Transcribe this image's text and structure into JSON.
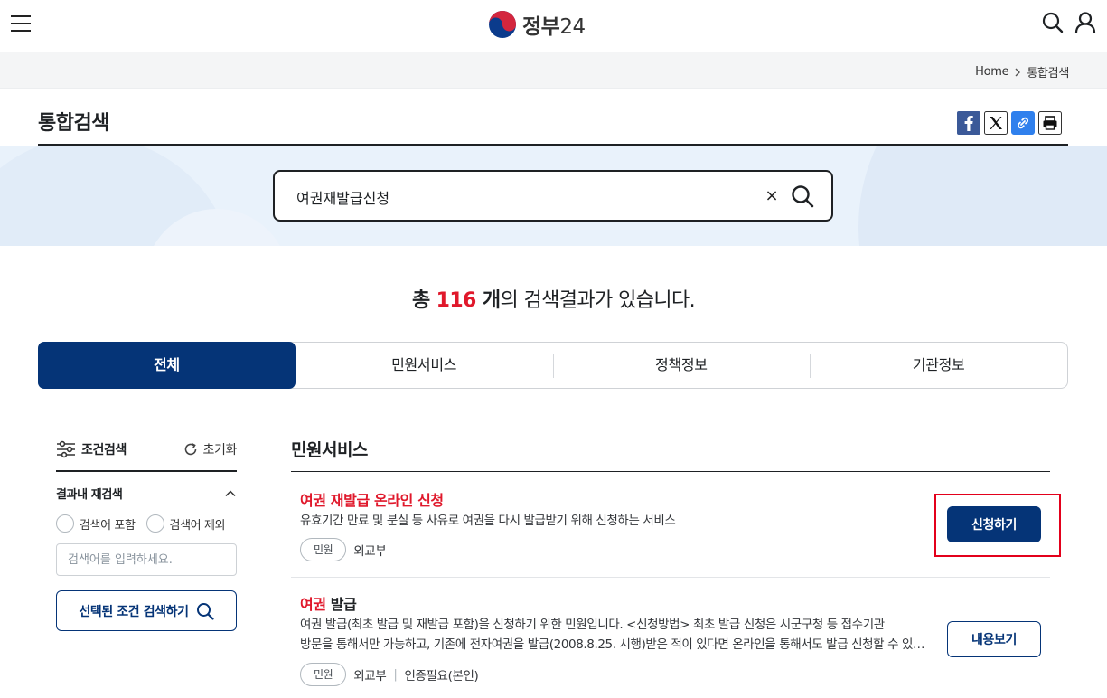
{
  "header": {
    "logo_text": "정부",
    "logo_num": "24",
    "colors": {
      "primary": "#053477",
      "accent_red": "#e0182b",
      "logo_blue": "#0b3b8c",
      "logo_red": "#d3263e"
    }
  },
  "breadcrumb": {
    "home": "Home",
    "current": "통합검색"
  },
  "page": {
    "title": "통합검색"
  },
  "share_icons": [
    "facebook-icon",
    "x-icon",
    "link-icon",
    "print-icon"
  ],
  "search": {
    "value": "여권재발급신청",
    "clear_label": "×"
  },
  "results": {
    "prefix": "총 ",
    "count": "116",
    "unit": " 개",
    "suffix": "의 검색결과가 있습니다."
  },
  "tabs": [
    {
      "label": "전체",
      "active": true
    },
    {
      "label": "민원서비스",
      "active": false
    },
    {
      "label": "정책정보",
      "active": false
    },
    {
      "label": "기관정보",
      "active": false
    }
  ],
  "filter": {
    "title": "조건검색",
    "reset": "초기화",
    "section_title": "결과내 재검색",
    "radio_include": "검색어 포함",
    "radio_exclude": "검색어 제외",
    "input_placeholder": "검색어를 입력하세요.",
    "submit": "선택된 조건 검색하기"
  },
  "section": {
    "title": "민원서비스",
    "items": [
      {
        "title_red": "여권 재발급 온라인 신청",
        "title_rest": "",
        "desc_lines": [
          "유효기간 만료 및 분실 등 사유로 여권을 다시 발급받기 위해 신청하는 서비스"
        ],
        "badge": "민원",
        "agency": "외교부",
        "extra": "",
        "button": "신청하기",
        "highlighted": true
      },
      {
        "title_red": "여권",
        "title_rest": " 발급",
        "desc_lines": [
          "여권 발급(최초 발급 및 재발급 포함)을 신청하기 위한 민원입니다. <신청방법> 최초 발급 신청은 시군구청 등 접수기관",
          "방문을 통해서만 가능하고, 기존에 전자여권을 발급(2008.8.25. 시행)받은 적이 있다면 온라인을 통해서도 발급 신청할 수 있습니다."
        ],
        "badge": "민원",
        "agency": "외교부",
        "extra": "인증필요(본인)",
        "button": "내용보기",
        "highlighted": false
      }
    ]
  }
}
